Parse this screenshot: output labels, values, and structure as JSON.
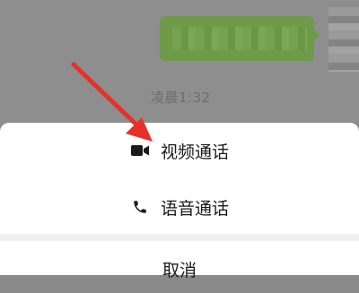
{
  "chat": {
    "timestamp": "凌晨1:32"
  },
  "sheet": {
    "options": [
      {
        "label": "视频通话",
        "icon": "video-camera-icon"
      },
      {
        "label": "语音通话",
        "icon": "phone-icon"
      }
    ],
    "cancel_label": "取消"
  },
  "colors": {
    "arrow": "#e8302a",
    "bubble": "#6e9a4a",
    "overlay": "#8e8e8e",
    "sheet": "#ffffff"
  }
}
